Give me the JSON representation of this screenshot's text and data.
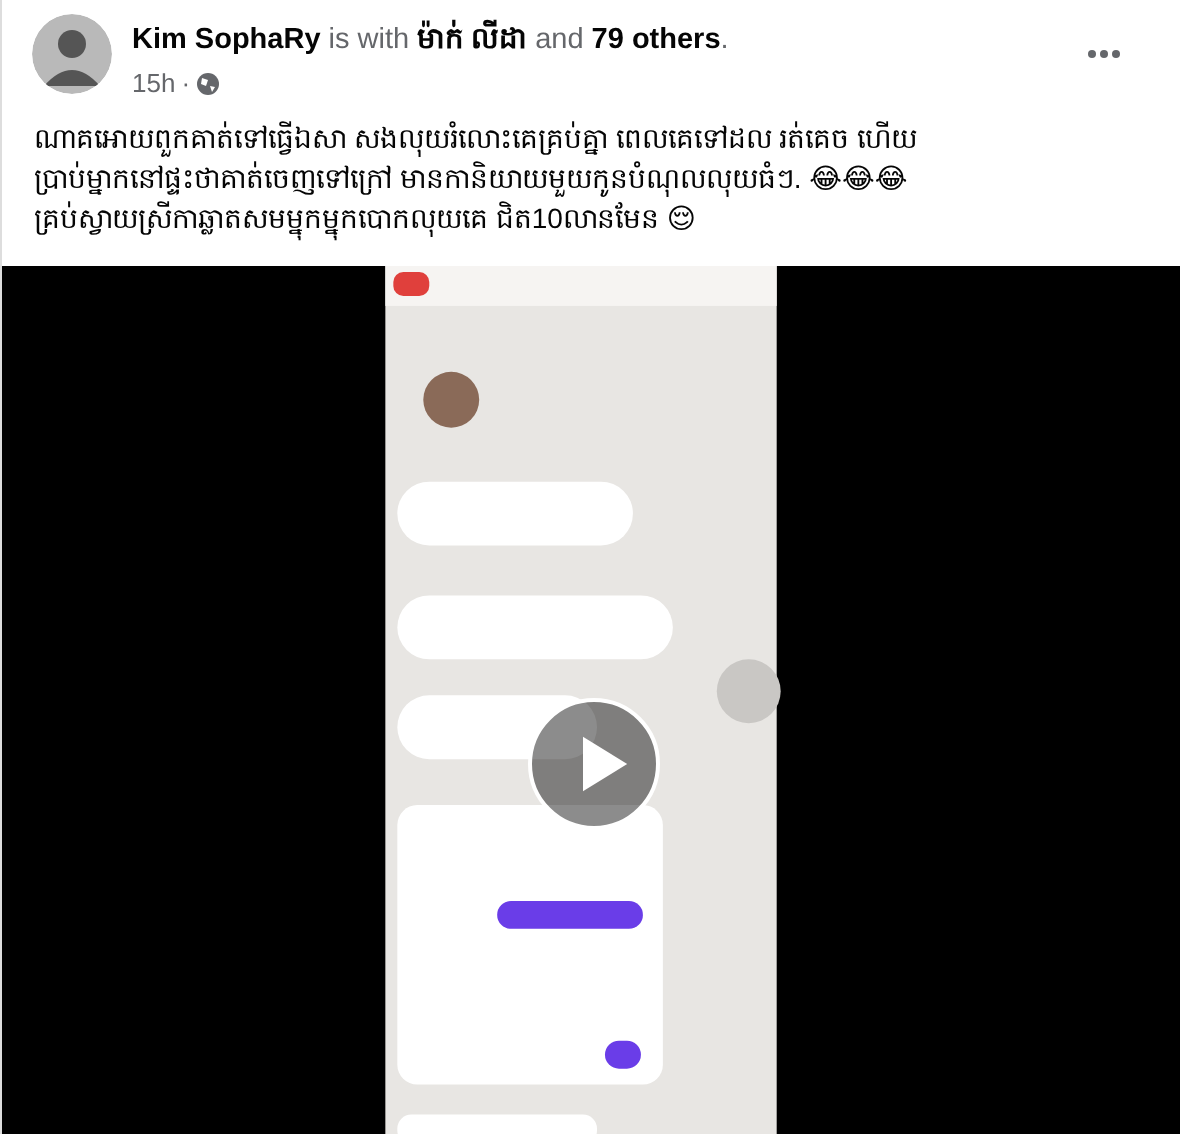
{
  "post": {
    "author": "Kim SophaRy",
    "with_text": "is with",
    "tagged": "ម៉ាក់ លីដា",
    "and_text": "and",
    "others": "79 others",
    "period": ".",
    "time": "15h",
    "separator": "·",
    "text": "ណាគអោយពួកគាត់ទៅធ្វើឯសា សងលុយរំលោះគេគ្រប់គ្នា ពេលគេទៅដល រត់គេច  ហើយ\nប្រាប់ម្នាកនៅផ្ទះថាគាត់ចេញទៅក្រៅ មានកានិយាយមួយកូនបំណុលលុយធំៗ. 😂😂😂\nគ្រប់ស្វាយស្រីកាឆ្លាតសមម្នុកម្នុកបោកលុយគេ ជិត10លានមែន 😌"
  }
}
